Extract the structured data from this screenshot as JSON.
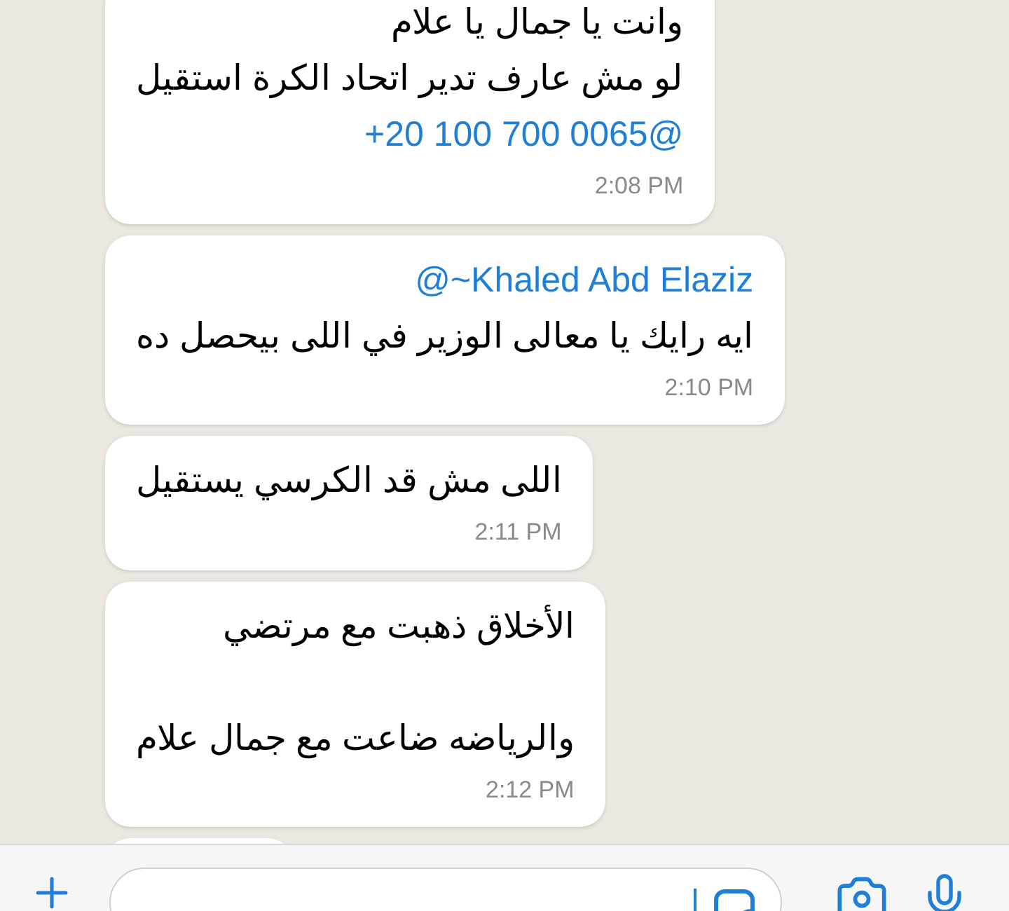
{
  "messages": [
    {
      "lines": [
        {
          "kind": "text",
          "text": "وانت يا جمال يا علام"
        },
        {
          "kind": "text",
          "text": "لو مش عارف تدير اتحاد الكرة استقيل"
        },
        {
          "kind": "mention",
          "text": "+20 100 700 0065@"
        }
      ],
      "time": "2:08 PM"
    },
    {
      "lines": [
        {
          "kind": "mention",
          "text": "@~Khaled Abd Elaziz"
        },
        {
          "kind": "text",
          "text": "ايه رايك يا معالى الوزير في اللى بيحصل ده"
        }
      ],
      "time": "2:10 PM"
    },
    {
      "lines": [
        {
          "kind": "text",
          "text": "اللى مش قد الكرسي يستقيل"
        }
      ],
      "time": "2:11 PM"
    },
    {
      "lines": [
        {
          "kind": "text",
          "text": "الأخلاق ذهبت مع مرتضي"
        },
        {
          "kind": "blank"
        },
        {
          "kind": "text",
          "text": "والرياضه ضاعت مع جمال علام"
        }
      ],
      "time": "2:12 PM"
    },
    {
      "lines": [
        {
          "kind": "cut"
        }
      ]
    }
  ]
}
